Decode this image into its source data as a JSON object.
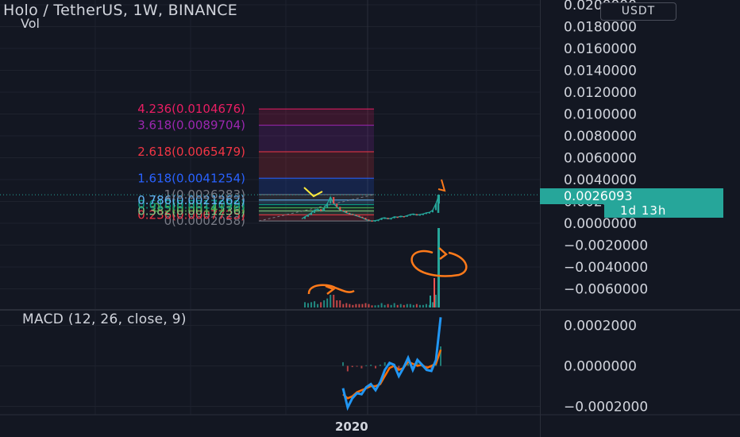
{
  "header": {
    "title": "Holo / TetherUS, 1W, BINANCE",
    "volume_label": "Vol",
    "unit": "USDT"
  },
  "price_tag": {
    "value": "0.0026093",
    "countdown": "1d 13h"
  },
  "x_axis": {
    "label": "2020"
  },
  "colors": {
    "background": "#131722",
    "bull": "#26a69a",
    "bear": "#ef5350",
    "macd_line": "#2196f3",
    "signal_line": "#ff6d00",
    "annotation_yellow": "#ffeb3b",
    "annotation_orange": "#ff7a1a"
  },
  "chart_data": [
    {
      "type": "line",
      "title": "Holo / TetherUS, 1W, BINANCE",
      "y_axis_ticks": [
        "0.0200000",
        "0.0180000",
        "0.0160000",
        "0.0140000",
        "0.0120000",
        "0.0100000",
        "0.0080000",
        "0.0060000",
        "0.0040000",
        "0.0020000",
        "0.0000000",
        "−0.0020000",
        "−0.0040000",
        "−0.0060000"
      ],
      "ylim": [
        -0.0072,
        0.0205
      ],
      "fib_levels": [
        {
          "ratio": "0",
          "price": 0.0002058,
          "label": "0(0.0002058)",
          "color": "#787b86"
        },
        {
          "ratio": "0.236",
          "price": 0.0007725,
          "label": "0.236(0.0007725)",
          "color": "#f23645"
        },
        {
          "ratio": "0.382",
          "price": 0.0011236,
          "label": "0.382(0.0011236)",
          "color": "#81c784"
        },
        {
          "ratio": "0.5",
          "price": 0.001417,
          "label": "0.5(0.0014170)",
          "color": "#4caf50"
        },
        {
          "ratio": "0.618",
          "price": 0.0017099,
          "label": "0.618(0.0017099)",
          "color": "#089981"
        },
        {
          "ratio": "0.786",
          "price": 0.0021262,
          "label": "0.786(0.0021262)",
          "color": "#64b5f6"
        },
        {
          "ratio": "1",
          "price": 0.0026283,
          "label": "1(0.0026283)",
          "color": "#787b86"
        },
        {
          "ratio": "1.618",
          "price": 0.0041254,
          "label": "1.618(0.0041254)",
          "color": "#2962ff"
        },
        {
          "ratio": "2.618",
          "price": 0.0065479,
          "label": "2.618(0.0065479)",
          "color": "#f23645"
        },
        {
          "ratio": "3.618",
          "price": 0.0089704,
          "label": "3.618(0.0089704)",
          "color": "#9c27b0"
        },
        {
          "ratio": "4.236",
          "price": 0.0104676,
          "label": "4.236(0.0104676)",
          "color": "#e91e63"
        }
      ],
      "price_series": {
        "name": "HOTUSDT",
        "week_index": [
          0,
          2,
          4,
          6,
          8,
          10,
          12,
          14,
          16,
          18,
          20,
          22,
          24,
          26,
          28,
          30,
          32,
          34,
          36,
          38,
          40,
          42,
          44,
          46,
          48,
          50,
          52,
          54,
          56,
          58,
          60,
          62,
          64,
          66,
          68,
          70,
          72,
          74,
          76,
          78,
          80,
          82,
          84,
          86
        ],
        "close": [
          0.0004,
          0.0006,
          0.00075,
          0.00095,
          0.0012,
          0.0013,
          0.0011,
          0.0014,
          0.0018,
          0.0024,
          0.0018,
          0.0015,
          0.0012,
          0.0011,
          0.00095,
          0.00085,
          0.0008,
          0.0007,
          0.0006,
          0.0005,
          0.00035,
          0.00025,
          0.00022,
          0.00025,
          0.0003,
          0.00045,
          0.0005,
          0.0004,
          0.00045,
          0.0006,
          0.00055,
          0.00065,
          0.0006,
          0.0007,
          0.0008,
          0.00085,
          0.00075,
          0.0008,
          0.00085,
          0.00095,
          0.001,
          0.0012,
          0.0018,
          0.00261
        ]
      },
      "last_price": 0.0026093
    },
    {
      "type": "line",
      "title": "MACD (12, 26, close, 9)",
      "y_axis_ticks": [
        "0.0002000",
        "0.0000000",
        "−0.0002000"
      ],
      "ylim": [
        -0.00025,
        0.00027
      ],
      "series": [
        {
          "name": "MACD",
          "x": [
            0,
            3,
            6,
            9,
            12,
            15,
            18,
            21,
            24,
            27,
            30,
            33,
            36,
            39,
            42,
            45,
            48,
            51,
            54,
            57,
            60,
            63
          ],
          "y": [
            -0.00011,
            -0.000205,
            -0.00016,
            -0.000135,
            -0.00014,
            -0.000105,
            -9e-05,
            -0.00012,
            -8e-05,
            -2e-05,
            1.5e-05,
            5e-06,
            -5e-05,
            -1e-05,
            4e-05,
            -2e-05,
            3e-05,
            5e-06,
            -2e-05,
            -2.5e-05,
            3e-05,
            0.00024
          ]
        },
        {
          "name": "Signal",
          "x": [
            0,
            3,
            6,
            9,
            12,
            15,
            18,
            21,
            24,
            27,
            30,
            33,
            36,
            39,
            42,
            45,
            48,
            51,
            54,
            57,
            60,
            63
          ],
          "y": [
            -0.00014,
            -0.00016,
            -0.00015,
            -0.00013,
            -0.00012,
            -0.00011,
            -0.0001,
            -0.0001,
            -9e-05,
            -5e-05,
            -1e-05,
            0.0,
            -2e-05,
            -1e-05,
            2e-05,
            1e-05,
            0.0,
            5e-06,
            -1e-05,
            0.0,
            1e-05,
            8e-05
          ]
        }
      ]
    }
  ]
}
